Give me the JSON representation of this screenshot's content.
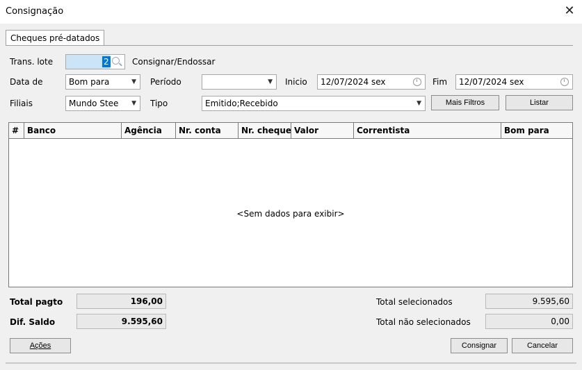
{
  "window": {
    "title": "Consignação",
    "close_glyph": "✕"
  },
  "tabs": [
    {
      "label": "Cheques pré-datados"
    }
  ],
  "filters": {
    "trans_lote_label": "Trans. lote",
    "trans_lote_value": "2",
    "consignar_label": "Consignar/Endossar",
    "data_de_label": "Data de",
    "data_de_value": "Bom para",
    "periodo_label": "Período",
    "periodo_value": "",
    "inicio_label": "Inicio",
    "inicio_value": "12/07/2024 sex",
    "fim_label": "Fim",
    "fim_value": "12/07/2024 sex",
    "filiais_label": "Filiais",
    "filiais_value": "Mundo Stee",
    "tipo_label": "Tipo",
    "tipo_value": "Emitido;Recebido",
    "mais_filtros_label": "Mais Filtros",
    "listar_label": "Listar"
  },
  "grid": {
    "columns": [
      "#",
      "Banco",
      "Agência",
      "Nr. conta",
      "Nr. cheque",
      "Valor",
      "Correntista",
      "Bom para"
    ],
    "empty_text": "<Sem dados para exibir>"
  },
  "totals": {
    "total_pagto_label": "Total pagto",
    "total_pagto_value": "196,00",
    "dif_saldo_label": "Dif. Saldo",
    "dif_saldo_value": "9.595,60",
    "total_selecionados_label": "Total selecionados",
    "total_selecionados_value": "9.595,60",
    "total_nao_selecionados_label": "Total não selecionados",
    "total_nao_selecionados_value": "0,00"
  },
  "actions": {
    "acoes_label": "Ações",
    "consignar_label": "Consignar",
    "cancelar_label": "Cancelar"
  }
}
